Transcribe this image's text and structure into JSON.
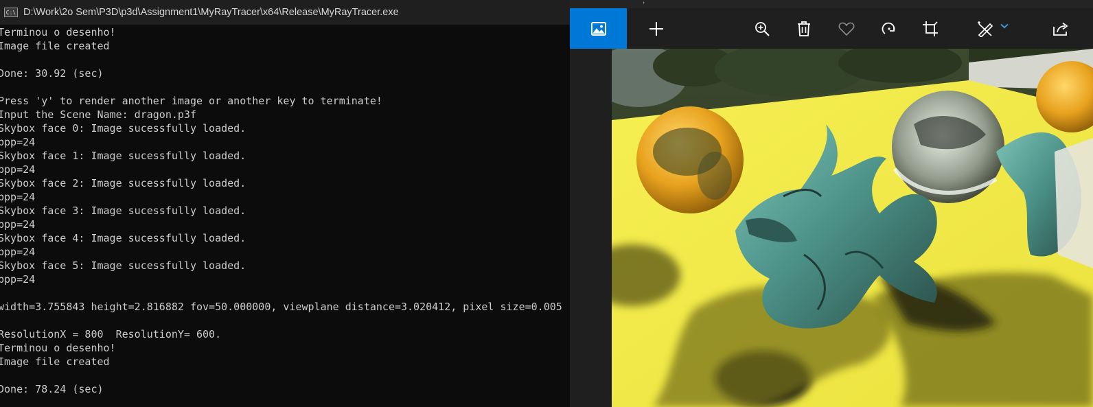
{
  "console": {
    "title": "D:\\Work\\2o Sem\\P3D\\p3d\\Assignment1\\MyRayTracer\\x64\\Release\\MyRayTracer.exe",
    "icon_text": "C:\\",
    "lines": [
      "Terminou o desenho!",
      "Image file created",
      "",
      "Done: 30.92 (sec)",
      "",
      "Press 'y' to render another image or another key to terminate!",
      "Input the Scene Name: dragon.p3f",
      "Skybox face 0: Image sucessfully loaded.",
      "bpp=24",
      "Skybox face 1: Image sucessfully loaded.",
      "bpp=24",
      "Skybox face 2: Image sucessfully loaded.",
      "bpp=24",
      "Skybox face 3: Image sucessfully loaded.",
      "bpp=24",
      "Skybox face 4: Image sucessfully loaded.",
      "bpp=24",
      "Skybox face 5: Image sucessfully loaded.",
      "bpp=24",
      "",
      "width=3.755843 height=2.816882 fov=50.000000, viewplane distance=3.020412, pixel size=0.005",
      "",
      "ResolutionX = 800  ResolutionY= 600.",
      "Terminou o desenho!",
      "Image file created",
      "",
      "Done: 78.24 (sec)"
    ]
  },
  "photos": {
    "title_fragment": ",",
    "accent_color": "#0078d7",
    "toolbar": {
      "view": "image-icon",
      "add": "plus-icon",
      "zoom": "zoom-in-icon",
      "delete": "trash-icon",
      "favorite": "heart-icon",
      "rotate": "rotate-icon",
      "crop": "crop-icon",
      "edit": "edit-create-icon",
      "share": "share-icon"
    },
    "image_description_colors": {
      "floor": "#f3ec4d",
      "golden_sphere": "#e8a21e",
      "dragon": "#4a8f86"
    }
  }
}
